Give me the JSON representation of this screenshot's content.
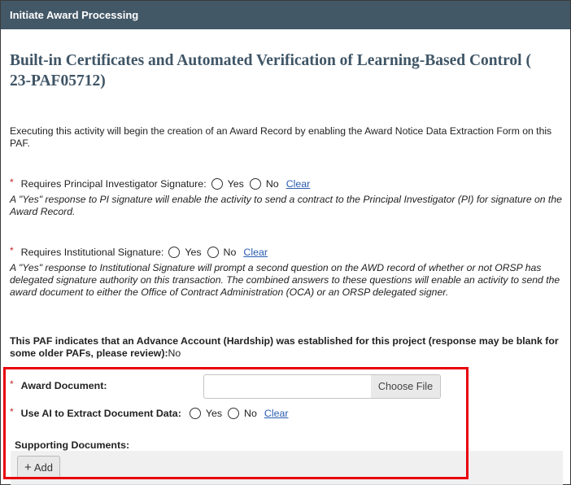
{
  "window": {
    "title": "Initiate Award Processing"
  },
  "header": {
    "project_title": "Built-in Certificates and Automated Verification of Learning-Based Control (  23-PAF05712)"
  },
  "intro_text": "Executing this activity will begin the creation of an Award Record by enabling the Award Notice Data Extraction Form on this PAF.",
  "questions": {
    "pi_signature": {
      "required_marker": "*",
      "label": "Requires Principal Investigator Signature:",
      "options": [
        "Yes",
        "No"
      ],
      "selected": null,
      "clear_label": "Clear",
      "help_text": "A \"Yes\" response to PI signature will enable the activity to send a contract to the Principal Investigator (PI) for signature on the Award Record."
    },
    "institutional_signature": {
      "required_marker": "*",
      "label": "Requires Institutional Signature:",
      "options": [
        "Yes",
        "No"
      ],
      "selected": null,
      "clear_label": "Clear",
      "help_text": "A \"Yes\" response to Institutional Signature will prompt a second question on the AWD record of whether or not ORSP has delegated signature authority on this transaction.  The combined answers to these questions will enable an activity to send the award document to either the Office of Contract Administration (OCA) or an ORSP delegated signer."
    }
  },
  "hardship": {
    "label": "This PAF indicates that an Advance Account (Hardship) was established for this project (response may be blank for some older PAFs, please review):",
    "value": "No"
  },
  "award_document": {
    "required_marker": "*",
    "label": "Award Document:",
    "file_value": "",
    "choose_file_label": "Choose File"
  },
  "use_ai": {
    "required_marker": "*",
    "label": "Use AI to Extract Document Data:",
    "options": [
      "Yes",
      "No"
    ],
    "selected": null,
    "clear_label": "Clear"
  },
  "supporting_documents": {
    "label": "Supporting Documents:",
    "add_label": "Add",
    "add_icon": "plus-icon"
  },
  "colors": {
    "titlebar": "#435867",
    "title_text": "#3f5566",
    "required": "#c0282d",
    "link": "#2a5db0",
    "highlight": "#e8000b"
  }
}
